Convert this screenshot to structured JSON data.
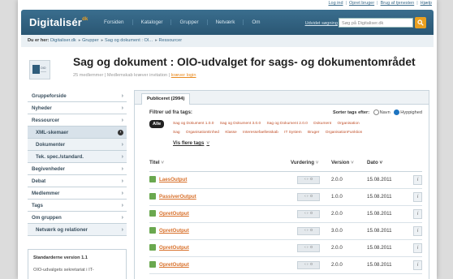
{
  "toplinks": [
    "Log ind",
    "Opret bruger",
    "Brug af tjenesten",
    "Hjælp"
  ],
  "header": {
    "logo": "Digitalisér",
    "logo_suffix": "dk",
    "nav": [
      "Forsiden",
      "Kataloger",
      "Grupper",
      "Netværk",
      "Om"
    ],
    "advanced_search": "Udvidet søgning",
    "search_placeholder": "Søg på Digitaliser.dk"
  },
  "breadcrumb": {
    "label": "Du er her:",
    "items": [
      "Digitaliser.dk",
      "Grupper",
      "Sag og dokument : OI...",
      "Ressourcer"
    ]
  },
  "group": {
    "title": "Sag og dokument : OIO-udvalget for sags- og dokumentområdet",
    "members_text": "25 medlemmer | Medlemskab kræver invitation |",
    "login_link": "kræver login"
  },
  "sidebar": {
    "items": [
      {
        "label": "Gruppeforside",
        "sub": false,
        "active": false
      },
      {
        "label": "Nyheder",
        "sub": false,
        "active": false
      },
      {
        "label": "Ressourcer",
        "sub": false,
        "active": false
      },
      {
        "label": "XML-skemaer",
        "sub": true,
        "active": true
      },
      {
        "label": "Dokumenter",
        "sub": true,
        "active": false
      },
      {
        "label": "Tek. spec./standard.",
        "sub": true,
        "active": false
      },
      {
        "label": "Begivenheder",
        "sub": false,
        "active": false
      },
      {
        "label": "Debat",
        "sub": false,
        "active": false
      },
      {
        "label": "Medlemmer",
        "sub": false,
        "active": false
      },
      {
        "label": "Tags",
        "sub": false,
        "active": false
      },
      {
        "label": "Om gruppen",
        "sub": false,
        "active": false
      },
      {
        "label": "Netværk og relationer",
        "sub": true,
        "active": false
      }
    ],
    "box_title": "Standarderne version 1.1",
    "box_text": "OIO-udvalgets sekretariat i IT-"
  },
  "main": {
    "tab": "Publiceret (2994)",
    "filter_heading": "Filtrer ud fra tags:",
    "sort_label": "Sorter tags efter:",
    "sort_name": "Navn",
    "sort_freq": "Hyppighed",
    "all_tag": "Alle",
    "tags_line1": [
      "Sag og Dokument 1.0.0",
      "Sag og Dokument 3.0.0",
      "Sag og Dokument 2.0.0",
      "Dokument",
      "Organisation"
    ],
    "tags_line2": [
      "Sag",
      "OrganisationEnhed",
      "Klasse",
      "Interessefaellesskab",
      "IT System",
      "Bruger",
      "OrganisationFunktion"
    ],
    "show_more": "Vis flere tags",
    "columns": {
      "title": "Titel",
      "rating": "Vurdering",
      "version": "Version",
      "date": "Dato"
    },
    "rows": [
      {
        "title": "LaesOutput",
        "version": "2.0.0",
        "date": "15.08.2011"
      },
      {
        "title": "PassiverOutput",
        "version": "1.0.0",
        "date": "15.08.2011"
      },
      {
        "title": "OpretOutput",
        "version": "2.0.0",
        "date": "15.08.2011"
      },
      {
        "title": "OpretOutput",
        "version": "3.0.0",
        "date": "15.08.2011"
      },
      {
        "title": "OpretOutput",
        "version": "2.0.0",
        "date": "15.08.2011"
      },
      {
        "title": "OpretOutput",
        "version": "2.0.0",
        "date": "15.08.2011"
      }
    ]
  }
}
